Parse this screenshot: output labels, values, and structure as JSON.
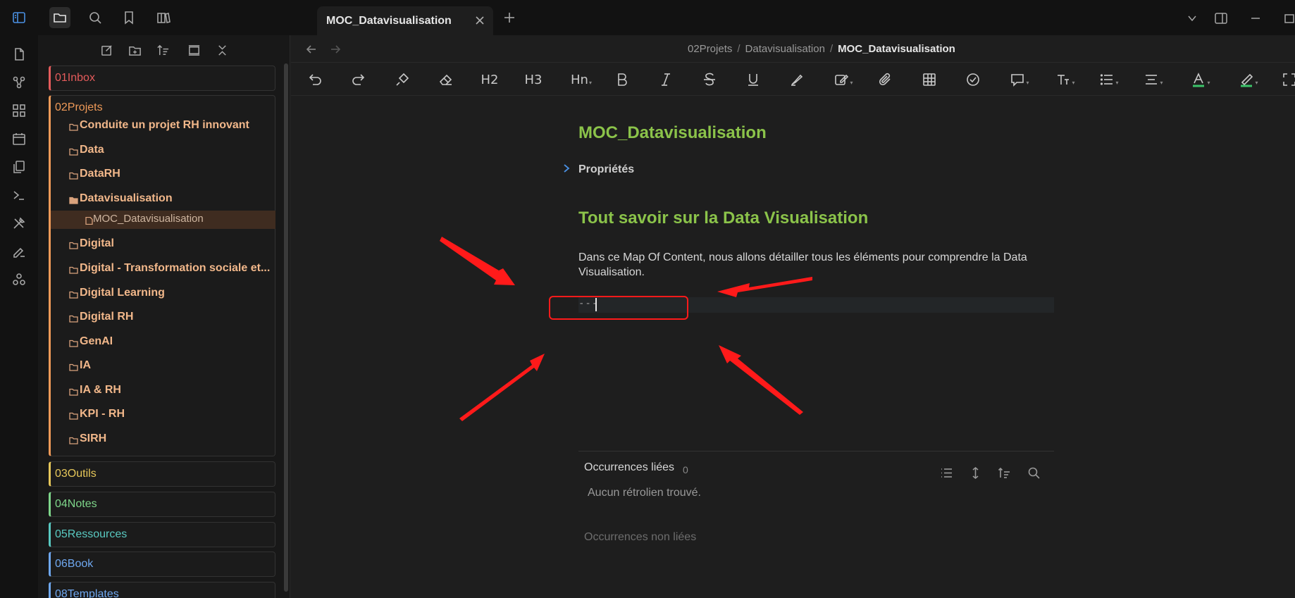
{
  "window": {
    "tab_title": "MOC_Datavisualisation"
  },
  "sidebar": {
    "folders": [
      {
        "label": "01Inbox",
        "color": "#e45b5b"
      },
      {
        "label": "02Projets",
        "color": "#ef9a58"
      },
      {
        "label": "03Outils",
        "color": "#e6c75a"
      },
      {
        "label": "04Notes",
        "color": "#7ed68a"
      },
      {
        "label": "05Ressources",
        "color": "#59c9c1"
      },
      {
        "label": "06Book",
        "color": "#6fa8f0"
      },
      {
        "label": "08Templates",
        "color": "#6fa8f0"
      }
    ],
    "projets_items": [
      "Conduite un projet RH innovant",
      "Data",
      "DataRH",
      "Datavisualisation",
      "MOC_Datavisualisation",
      "Digital",
      "Digital - Transformation sociale et...",
      "Digital Learning",
      "Digital RH",
      "GenAI",
      "IA",
      "IA & RH",
      "KPI - RH",
      "SIRH"
    ]
  },
  "breadcrumb": {
    "parts": [
      "02Projets",
      "Datavisualisation"
    ],
    "current": "MOC_Datavisualisation",
    "separator": "/"
  },
  "toolbar": {
    "h2": "H2",
    "h3": "H3",
    "hn": "Hn"
  },
  "note": {
    "title": "MOC_Datavisualisation",
    "properties_label": "Propriétés",
    "heading": "Tout savoir sur la Data Visualisation",
    "paragraph": "Dans ce Map Of Content, nous allons détailler tous les éléments pour comprendre la Data Visualisation.",
    "active_line": "---"
  },
  "backlinks": {
    "title": "Occurrences liées",
    "count": "0",
    "empty": "Aucun rétrolien trouvé.",
    "unlinked": "Occurrences non liées"
  },
  "annotation": {
    "color": "#ff1a1a"
  }
}
